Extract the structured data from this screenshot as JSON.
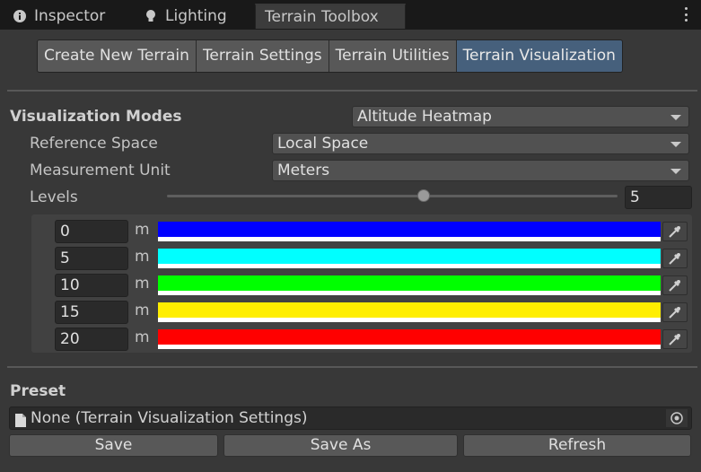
{
  "tabs": [
    {
      "label": "Inspector",
      "icon": "info-icon"
    },
    {
      "label": "Lighting",
      "icon": "lightbulb-icon"
    },
    {
      "label": "Terrain Toolbox",
      "icon": ""
    }
  ],
  "toolbox_tabs": [
    "Create New Terrain",
    "Terrain Settings",
    "Terrain Utilities",
    "Terrain Visualization"
  ],
  "active_toolbox_tab": "Terrain Visualization",
  "visualization": {
    "modes_label": "Visualization Modes",
    "mode_value": "Altitude Heatmap",
    "reference_space_label": "Reference Space",
    "reference_space_value": "Local Space",
    "measurement_unit_label": "Measurement Unit",
    "measurement_unit_value": "Meters",
    "levels_label": "Levels",
    "levels_value": "5",
    "levels_slider_fraction": 0.57
  },
  "levels": [
    {
      "height": "0",
      "unit": "m",
      "color": "#0000ff"
    },
    {
      "height": "5",
      "unit": "m",
      "color": "#00ffff"
    },
    {
      "height": "10",
      "unit": "m",
      "color": "#00ff00"
    },
    {
      "height": "15",
      "unit": "m",
      "color": "#ffee00"
    },
    {
      "height": "20",
      "unit": "m",
      "color": "#ff0000"
    }
  ],
  "preset": {
    "label": "Preset",
    "value": "None (Terrain Visualization Settings)",
    "save_label": "Save",
    "save_as_label": "Save As",
    "refresh_label": "Refresh"
  }
}
